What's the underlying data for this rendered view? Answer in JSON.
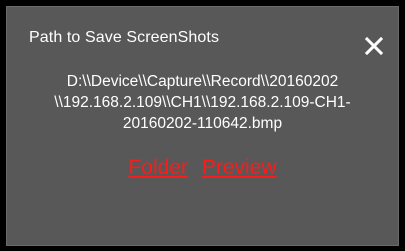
{
  "dialog": {
    "title": "Path to Save ScreenShots",
    "close_icon": "close-icon",
    "path_lines": [
      "D:\\\\Device\\\\Capture\\\\Record\\\\20160202",
      "\\\\192.168.2.109\\\\CH1\\\\192.168.2.109-CH1-",
      "20160202-110642.bmp"
    ],
    "links": {
      "folder": "Folder",
      "preview": "Preview"
    }
  },
  "colors": {
    "dialog_bg": "#585858",
    "text": "#ffffff",
    "link": "#ff1a1a"
  }
}
